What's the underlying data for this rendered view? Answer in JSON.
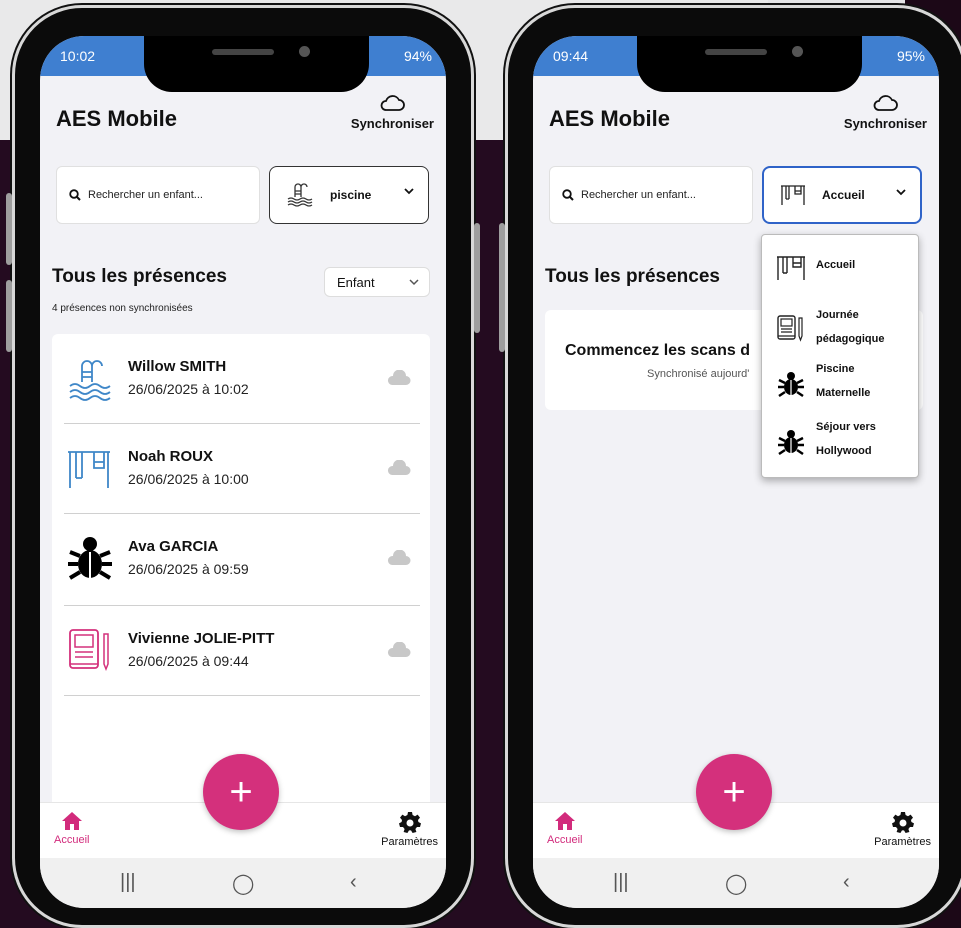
{
  "colors": {
    "accent": "#d4307c",
    "statusbar": "#3f7fd0",
    "dropdown_border": "#2f63c8",
    "background": "#240b20"
  },
  "left": {
    "status": {
      "time": "10:02",
      "battery": "94%"
    },
    "app_title": "AES Mobile",
    "sync_label": "Synchroniser",
    "search_placeholder": "Rechercher un enfant...",
    "activity": {
      "icon": "pool-icon",
      "label": "piscine"
    },
    "section_title": "Tous les présences",
    "unsynced": "4 présences non synchronisées",
    "sort_label": "Enfant",
    "rows": [
      {
        "icon": "pool-icon",
        "name": "Willow SMITH",
        "date": "26/06/2025 à 10:02"
      },
      {
        "icon": "playground-icon",
        "name": "Noah ROUX",
        "date": "26/06/2025 à 10:00"
      },
      {
        "icon": "bug-icon",
        "name": "Ava GARCIA",
        "date": "26/06/2025 à 09:59"
      },
      {
        "icon": "notebook-icon",
        "name": "Vivienne JOLIE-PITT",
        "date": "26/06/2025 à 09:44"
      }
    ],
    "nav": {
      "home": "Accueil",
      "settings": "Paramètres"
    }
  },
  "right": {
    "status": {
      "time": "09:44",
      "battery": "95%"
    },
    "app_title": "AES Mobile",
    "sync_label": "Synchroniser",
    "search_placeholder": "Rechercher un enfant...",
    "activity": {
      "icon": "playground-icon",
      "label": "Accueil"
    },
    "section_title": "Tous les présences",
    "empty_title": "Commencez les scans d",
    "empty_sub": "Synchronisé aujourd'",
    "dropdown": [
      {
        "icon": "playground-icon",
        "line1": "Accueil",
        "line2": ""
      },
      {
        "icon": "notebook-icon",
        "line1": "Journée",
        "line2": "pédagogique"
      },
      {
        "icon": "bug-icon",
        "line1": "Piscine",
        "line2": "Maternelle"
      },
      {
        "icon": "bug-icon",
        "line1": "Séjour vers",
        "line2": "Hollywood"
      }
    ],
    "nav": {
      "home": "Accueil",
      "settings": "Paramètres"
    }
  }
}
